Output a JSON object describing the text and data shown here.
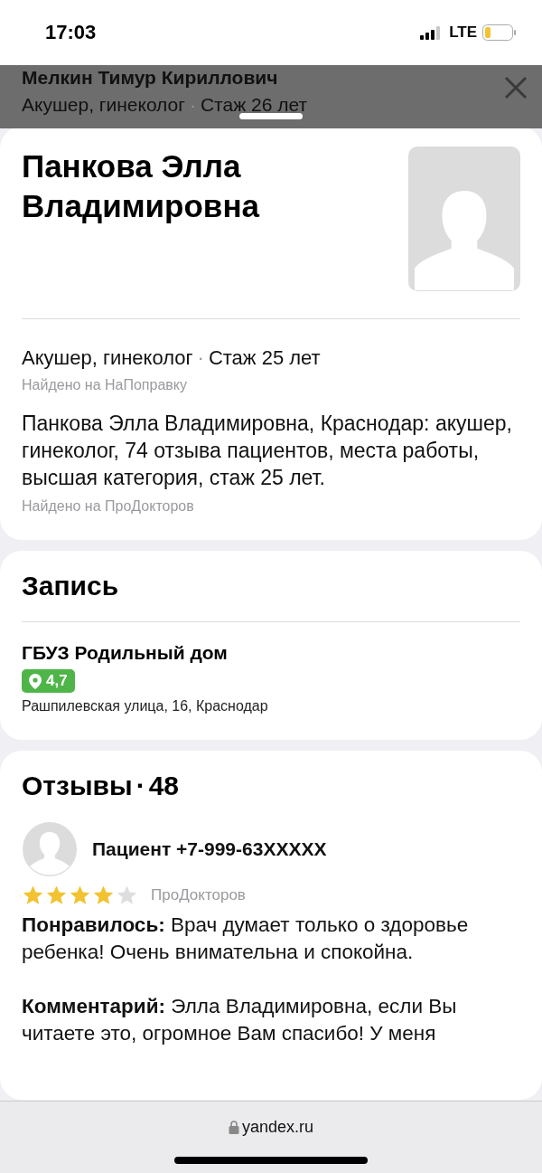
{
  "status_bar": {
    "time": "17:03",
    "network": "LTE"
  },
  "background_card": {
    "name": "Мелкин Тимур Кириллович",
    "specialty": "Акушер, гинеколог",
    "separator": "·",
    "experience": "Стаж 26 лет"
  },
  "doctor": {
    "name": "Панкова Элла Владимировна",
    "specialty": "Акушер, гинеколог",
    "separator": "·",
    "experience": "Стаж 25 лет",
    "specialty_source": "Найдено на НаПоправку",
    "description": "Панкова Элла Владимировна, Краснодар: акушер, гинеколог, 74 отзыва пациентов, места работы, высшая категория, стаж 25 лет.",
    "description_source": "Найдено на ПроДокторов"
  },
  "appointment": {
    "title": "Запись",
    "clinic": {
      "name": "ГБУЗ Родильный дом",
      "rating": "4,7",
      "address": "Рашпилевская улица, 16, Краснодар"
    }
  },
  "reviews": {
    "title": "Отзывы",
    "separator": "·",
    "count": "48",
    "items": [
      {
        "author": "Пациент +7-999-63XXXXX",
        "stars": 4,
        "source": "ПроДокторов",
        "paragraphs": [
          "**Понравилось:** Врач думает только о здоровье ребенка! Очень внимательна и спокойна.",
          "**Комментарий:** Элла Владимировна, если Вы читаете это, огромное Вам спасибо! У меня"
        ]
      }
    ]
  },
  "address_bar": {
    "url": "yandex.ru"
  }
}
